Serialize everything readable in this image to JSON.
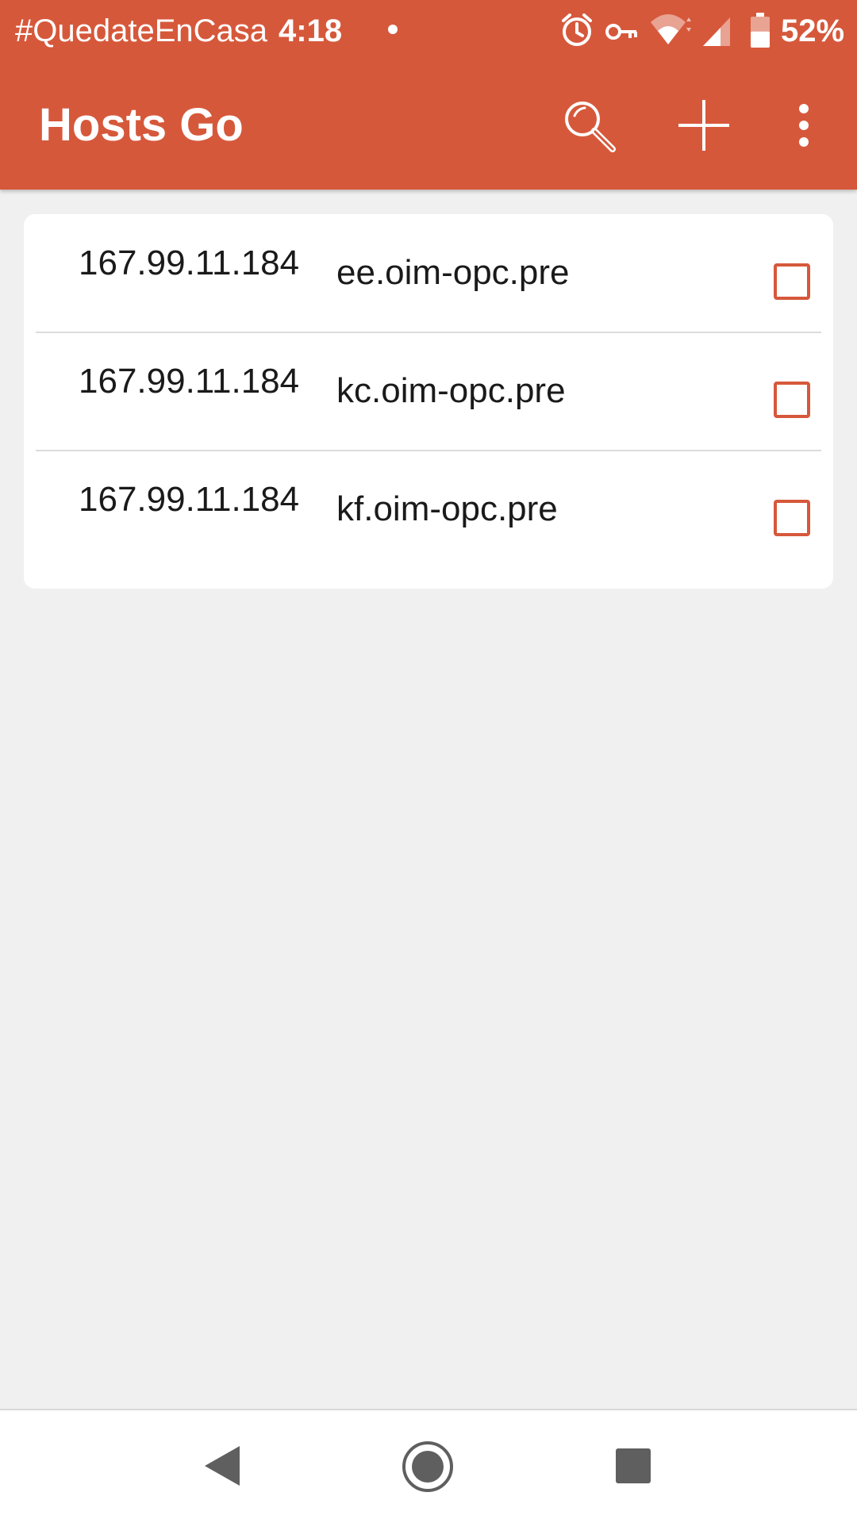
{
  "status_bar": {
    "carrier_text": "#QuedateEnCasa",
    "time": "4:18",
    "battery_percent": "52%",
    "battery_level": 0.52,
    "icons": [
      "alarm-icon",
      "vpn-key-icon",
      "wifi-icon",
      "signal-icon",
      "battery-icon"
    ]
  },
  "app_bar": {
    "title": "Hosts Go",
    "actions": [
      "search-icon",
      "add-icon",
      "more-vert-icon"
    ]
  },
  "hosts": [
    {
      "ip": "167.99.11.184",
      "hostname": "ee.oim-opc.pre",
      "checked": false
    },
    {
      "ip": "167.99.11.184",
      "hostname": "kc.oim-opc.pre",
      "checked": false
    },
    {
      "ip": "167.99.11.184",
      "hostname": "kf.oim-opc.pre",
      "checked": false
    }
  ],
  "nav_bar": {
    "buttons": [
      "back-icon",
      "home-icon",
      "recents-icon"
    ]
  },
  "colors": {
    "accent": "#d6583b",
    "background": "#f0f0f0",
    "card": "#ffffff"
  }
}
